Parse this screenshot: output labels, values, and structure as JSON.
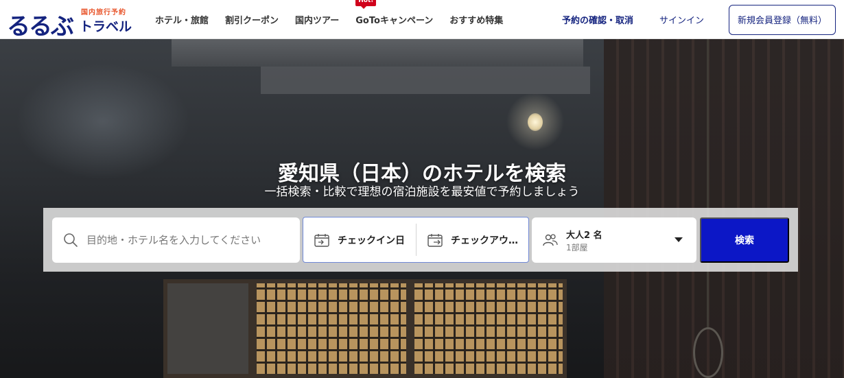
{
  "header": {
    "logo": {
      "main": "るるぶ",
      "sub": "国内旅行予約",
      "travel": "トラベル"
    },
    "nav": [
      {
        "label": "ホテル・旅館"
      },
      {
        "label": "割引クーポン"
      },
      {
        "label": "国内ツアー"
      },
      {
        "label": "GoToキャンペーン",
        "badge": "Hot!"
      },
      {
        "label": "おすすめ特集"
      }
    ],
    "reserve_label": "予約の確認・取消",
    "signin_label": "サインイン",
    "register_label": "新規会員登録（無料）"
  },
  "hero": {
    "title": "愛知県（日本）のホテルを検索",
    "subtitle": "一括検索・比較で理想の宿泊施設を最安値で予約しましょう"
  },
  "search": {
    "destination_placeholder": "目的地・ホテル名を入力してください",
    "checkin_label": "チェックイン日",
    "checkout_label": "チェックアウト日",
    "guests_main": "大人2 名",
    "guests_sub": "1部屋",
    "search_button": "検索"
  },
  "colors": {
    "brand": "#14237f",
    "accent": "#e8552b",
    "hot": "#d0011b",
    "search_button": "#0c17c6"
  },
  "icons": [
    "search-icon",
    "calendar-checkin-icon",
    "calendar-checkout-icon",
    "guests-icon",
    "caret-down-icon"
  ]
}
